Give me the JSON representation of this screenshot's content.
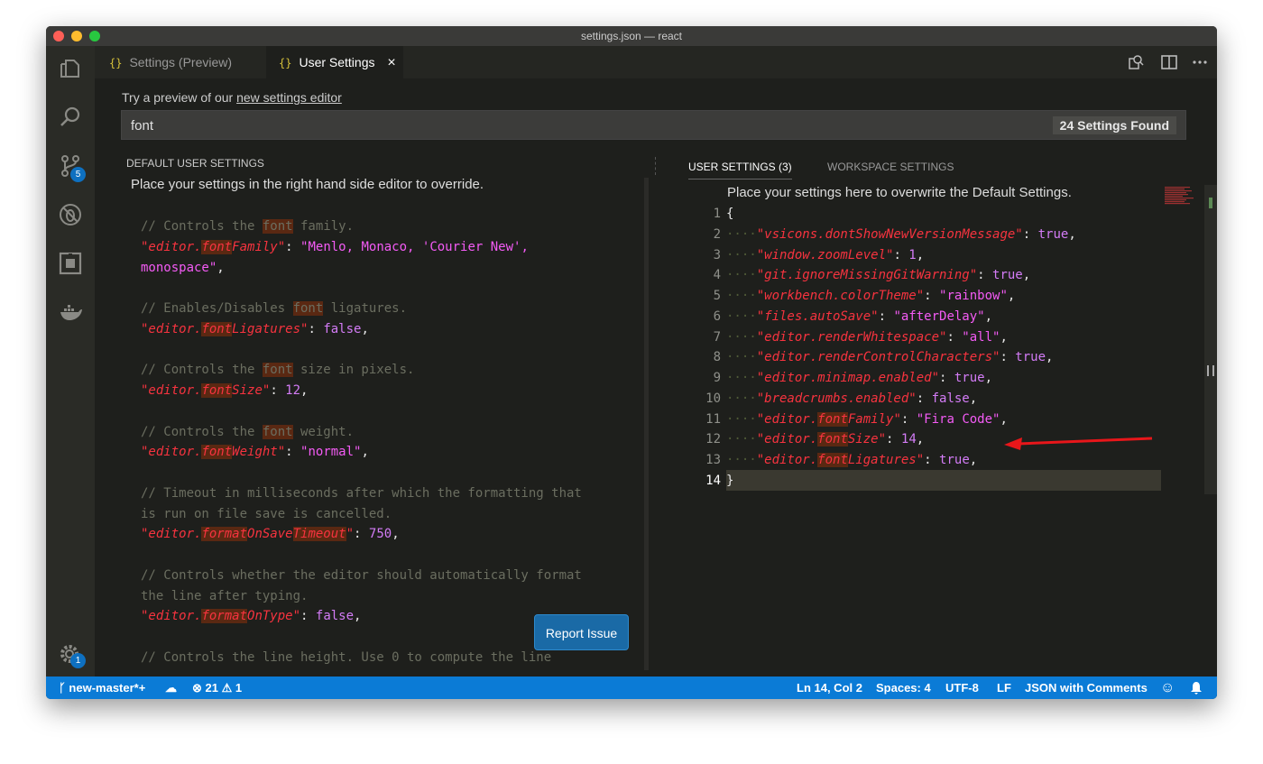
{
  "window": {
    "title": "settings.json — react",
    "traffic": [
      "#fe5f57",
      "#febc2e",
      "#28c840"
    ]
  },
  "activity_bar": {
    "scm_badge": "5",
    "settings_badge": "1"
  },
  "tabs": [
    {
      "label": "Settings (Preview)",
      "icon": "{}"
    },
    {
      "label": "User Settings",
      "icon": "{}",
      "close": "×"
    }
  ],
  "hint": {
    "prefix": "Try a preview of our ",
    "link": "new settings editor"
  },
  "search": {
    "value": "font",
    "found": "24 Settings Found"
  },
  "left_pane": {
    "title": "DEFAULT USER SETTINGS",
    "intro": "Place your settings in the right hand side editor to override.",
    "lines": [
      [
        [
          "cm",
          "// Controls the "
        ],
        [
          "cm hl",
          "font"
        ],
        [
          "cm",
          " family."
        ]
      ],
      [
        [
          "k",
          "\"editor."
        ],
        [
          "k hl",
          "font"
        ],
        [
          "k",
          "Family\""
        ],
        [
          "p",
          ": "
        ],
        [
          "s",
          "\"Menlo, Monaco, 'Courier New',"
        ]
      ],
      [
        [
          "s",
          "monospace\""
        ],
        [
          "p",
          ","
        ]
      ],
      [],
      [
        [
          "cm",
          "// Enables/Disables "
        ],
        [
          "cm hl",
          "font"
        ],
        [
          "cm",
          " ligatures."
        ]
      ],
      [
        [
          "k",
          "\"editor."
        ],
        [
          "k hl",
          "font"
        ],
        [
          "k",
          "Ligatures\""
        ],
        [
          "p",
          ": "
        ],
        [
          "n",
          "false"
        ],
        [
          "p",
          ","
        ]
      ],
      [],
      [
        [
          "cm",
          "// Controls the "
        ],
        [
          "cm hl",
          "font"
        ],
        [
          "cm",
          " size in pixels."
        ]
      ],
      [
        [
          "k",
          "\"editor."
        ],
        [
          "k hl",
          "font"
        ],
        [
          "k",
          "Size\""
        ],
        [
          "p",
          ": "
        ],
        [
          "n",
          "12"
        ],
        [
          "p",
          ","
        ]
      ],
      [],
      [
        [
          "cm",
          "// Controls the "
        ],
        [
          "cm hl",
          "font"
        ],
        [
          "cm",
          " weight."
        ]
      ],
      [
        [
          "k",
          "\"editor."
        ],
        [
          "k hl",
          "font"
        ],
        [
          "k",
          "Weight\""
        ],
        [
          "p",
          ": "
        ],
        [
          "s",
          "\"normal\""
        ],
        [
          "p",
          ","
        ]
      ],
      [],
      [
        [
          "cm",
          "// Timeout in milliseconds after which the formatting that"
        ]
      ],
      [
        [
          "cm",
          "is run on file save is cancelled."
        ]
      ],
      [
        [
          "k",
          "\"editor."
        ],
        [
          "k hl",
          "format"
        ],
        [
          "k",
          "OnSave"
        ],
        [
          "k hl",
          "Timeout"
        ],
        [
          "k",
          "\""
        ],
        [
          "p",
          ": "
        ],
        [
          "n",
          "750"
        ],
        [
          "p",
          ","
        ]
      ],
      [],
      [
        [
          "cm",
          "// Controls whether the editor should automatically format"
        ]
      ],
      [
        [
          "cm",
          "the line after typing."
        ]
      ],
      [
        [
          "k",
          "\"editor."
        ],
        [
          "k hl",
          "format"
        ],
        [
          "k",
          "OnType\""
        ],
        [
          "p",
          ": "
        ],
        [
          "n",
          "false"
        ],
        [
          "p",
          ","
        ]
      ],
      [],
      [
        [
          "cm",
          "// Controls the line height. Use 0 to compute the line"
        ]
      ]
    ],
    "report_button": "Report Issue"
  },
  "right_pane": {
    "tabs": [
      "USER SETTINGS (3)",
      "WORKSPACE SETTINGS"
    ],
    "intro": "Place your settings here to overwrite the Default Settings.",
    "line_numbers": [
      "1",
      "2",
      "3",
      "4",
      "5",
      "6",
      "7",
      "8",
      "9",
      "10",
      "11",
      "12",
      "13",
      "14"
    ],
    "lines": [
      [
        [
          "p",
          "{"
        ]
      ],
      [
        [
          "k",
          "\"vsicons.dontShowNewVersionMessage\""
        ],
        [
          "p",
          ": "
        ],
        [
          "n",
          "true"
        ],
        [
          "p",
          ","
        ]
      ],
      [
        [
          "k",
          "\"window.zoomLevel\""
        ],
        [
          "p",
          ": "
        ],
        [
          "n",
          "1"
        ],
        [
          "p",
          ","
        ]
      ],
      [
        [
          "k",
          "\"git.ignoreMissingGitWarning\""
        ],
        [
          "p",
          ": "
        ],
        [
          "n",
          "true"
        ],
        [
          "p",
          ","
        ]
      ],
      [
        [
          "k",
          "\"workbench.colorTheme\""
        ],
        [
          "p",
          ": "
        ],
        [
          "s",
          "\"rainbow\""
        ],
        [
          "p",
          ","
        ]
      ],
      [
        [
          "k",
          "\"files.autoSave\""
        ],
        [
          "p",
          ": "
        ],
        [
          "s",
          "\"afterDelay\""
        ],
        [
          "p",
          ","
        ]
      ],
      [
        [
          "k",
          "\"editor.renderWhitespace\""
        ],
        [
          "p",
          ": "
        ],
        [
          "s",
          "\"all\""
        ],
        [
          "p",
          ","
        ]
      ],
      [
        [
          "k",
          "\"editor.renderControlCharacters\""
        ],
        [
          "p",
          ": "
        ],
        [
          "n",
          "true"
        ],
        [
          "p",
          ","
        ]
      ],
      [
        [
          "k",
          "\"editor.minimap.enabled\""
        ],
        [
          "p",
          ": "
        ],
        [
          "n",
          "true"
        ],
        [
          "p",
          ","
        ]
      ],
      [
        [
          "k",
          "\"breadcrumbs.enabled\""
        ],
        [
          "p",
          ": "
        ],
        [
          "n",
          "false"
        ],
        [
          "p",
          ","
        ]
      ],
      [
        [
          "k",
          "\"editor."
        ],
        [
          "k hl",
          "font"
        ],
        [
          "k",
          "Family\""
        ],
        [
          "p",
          ": "
        ],
        [
          "s",
          "\"Fira Code\""
        ],
        [
          "p",
          ","
        ]
      ],
      [
        [
          "k",
          "\"editor."
        ],
        [
          "k hl",
          "font"
        ],
        [
          "k",
          "Size\""
        ],
        [
          "p",
          ": "
        ],
        [
          "n",
          "14"
        ],
        [
          "p",
          ","
        ]
      ],
      [
        [
          "k",
          "\"editor."
        ],
        [
          "k hl",
          "font"
        ],
        [
          "k",
          "Ligatures\""
        ],
        [
          "p",
          ": "
        ],
        [
          "n",
          "true"
        ],
        [
          "p",
          ","
        ]
      ],
      [
        [
          "p",
          "}"
        ]
      ]
    ]
  },
  "status_bar": {
    "branch": "new-master*+",
    "errors": "21",
    "warnings": "1",
    "position": "Ln 14, Col 2",
    "spaces": "Spaces: 4",
    "encoding": "UTF-8",
    "eol": "LF",
    "language": "JSON with Comments"
  },
  "colors": {
    "accent": "#0b7bd6",
    "arrow": "#e8161a"
  }
}
